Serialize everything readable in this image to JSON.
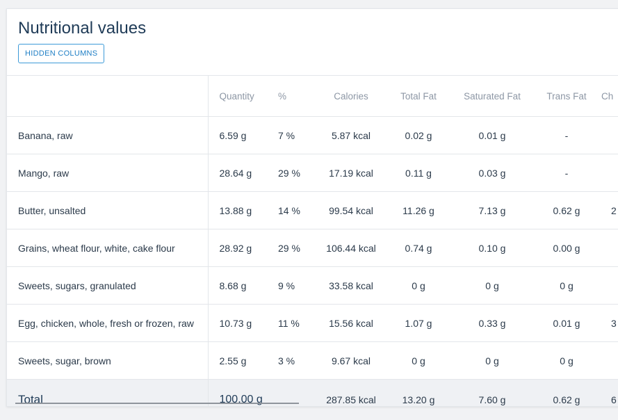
{
  "page": {
    "title": "Nutritional values",
    "hidden_columns_label": "HIDDEN COLUMNS"
  },
  "table": {
    "headers": {
      "name": "",
      "quantity": "Quantity",
      "percent": "%",
      "calories": "Calories",
      "total_fat": "Total Fat",
      "saturated_fat": "Saturated Fat",
      "trans_fat": "Trans Fat",
      "next_col": "Ch"
    },
    "rows": [
      {
        "name": "Banana, raw",
        "quantity": "6.59 g",
        "percent": "7 %",
        "calories": "5.87 kcal",
        "total_fat": "0.02 g",
        "saturated_fat": "0.01 g",
        "trans_fat": "-",
        "next_col": ""
      },
      {
        "name": "Mango, raw",
        "quantity": "28.64 g",
        "percent": "29 %",
        "calories": "17.19 kcal",
        "total_fat": "0.11 g",
        "saturated_fat": "0.03 g",
        "trans_fat": "-",
        "next_col": ""
      },
      {
        "name": "Butter, unsalted",
        "quantity": "13.88 g",
        "percent": "14 %",
        "calories": "99.54 kcal",
        "total_fat": "11.26 g",
        "saturated_fat": "7.13 g",
        "trans_fat": "0.62 g",
        "next_col": "2"
      },
      {
        "name": "Grains, wheat flour, white, cake flour",
        "quantity": "28.92 g",
        "percent": "29 %",
        "calories": "106.44 kcal",
        "total_fat": "0.74 g",
        "saturated_fat": "0.10 g",
        "trans_fat": "0.00 g",
        "next_col": ""
      },
      {
        "name": "Sweets, sugars, granulated",
        "quantity": "8.68 g",
        "percent": "9 %",
        "calories": "33.58 kcal",
        "total_fat": "0 g",
        "saturated_fat": "0 g",
        "trans_fat": "0 g",
        "next_col": ""
      },
      {
        "name": "Egg, chicken, whole, fresh or frozen, raw",
        "quantity": "10.73 g",
        "percent": "11 %",
        "calories": "15.56 kcal",
        "total_fat": "1.07 g",
        "saturated_fat": "0.33 g",
        "trans_fat": "0.01 g",
        "next_col": "3"
      },
      {
        "name": "Sweets, sugar, brown",
        "quantity": "2.55 g",
        "percent": "3 %",
        "calories": "9.67 kcal",
        "total_fat": "0 g",
        "saturated_fat": "0 g",
        "trans_fat": "0 g",
        "next_col": ""
      }
    ],
    "total": {
      "name": "Total",
      "quantity": "100.00 g",
      "percent": "",
      "calories": "287.85 kcal",
      "total_fat": "13.20 g",
      "saturated_fat": "7.60 g",
      "trans_fat": "0.62 g",
      "next_col": "6"
    }
  }
}
